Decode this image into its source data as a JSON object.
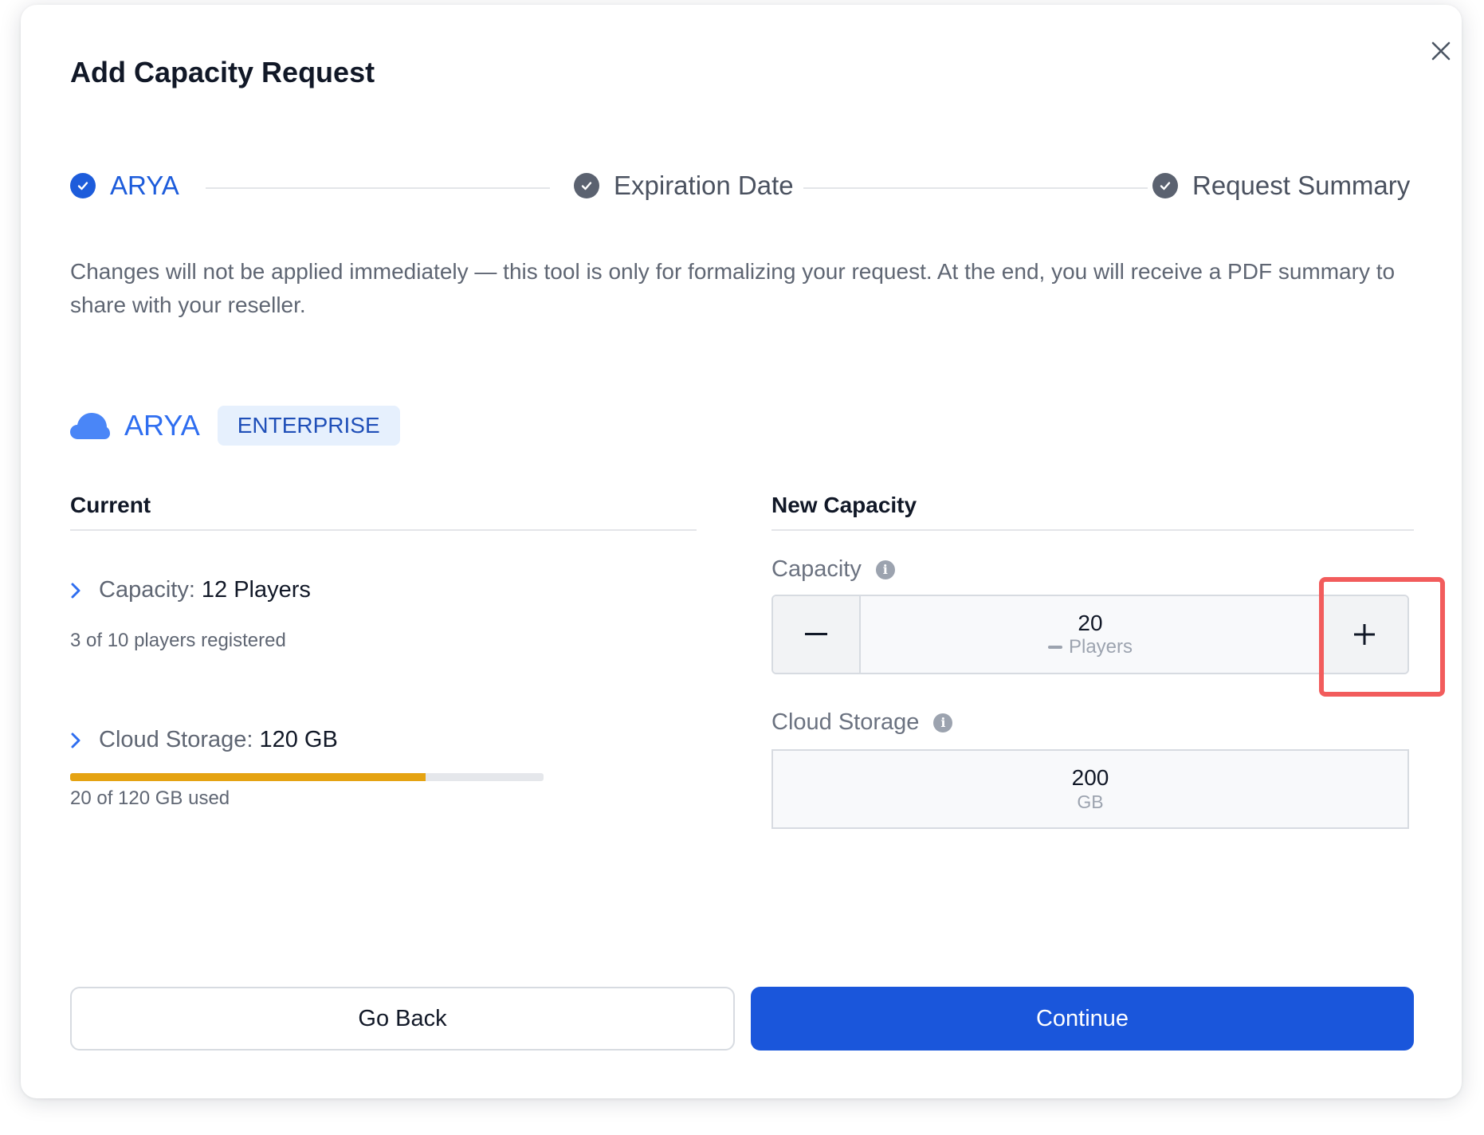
{
  "modal": {
    "title": "Add Capacity Request",
    "close_icon": "close-icon"
  },
  "stepper": {
    "steps": [
      {
        "label": "ARYA",
        "state": "active"
      },
      {
        "label": "Expiration Date",
        "state": "done"
      },
      {
        "label": "Request Summary",
        "state": "done"
      }
    ]
  },
  "description": "Changes will not be applied immediately — this tool is only for formalizing your request. At the end, you will receive a PDF summary to share with your reseller.",
  "product": {
    "name": "ARYA",
    "plan": "ENTERPRISE",
    "icon": "cloud-icon"
  },
  "current": {
    "heading": "Current",
    "capacity": {
      "label": "Capacity:",
      "value": "12 Players",
      "sub": "3 of 10 players registered"
    },
    "storage": {
      "label": "Cloud Storage:",
      "value": "120 GB",
      "sub": "20 of 120 GB used",
      "used_fraction": 0.75
    }
  },
  "new_capacity": {
    "heading": "New Capacity",
    "capacity": {
      "label": "Capacity",
      "value": "20",
      "unit": "Players"
    },
    "storage": {
      "label": "Cloud Storage",
      "value": "200",
      "unit": "GB"
    }
  },
  "actions": {
    "back": "Go Back",
    "continue": "Continue"
  },
  "colors": {
    "primary": "#1a56db",
    "accent_text": "#2f6ef0",
    "progress_fill": "#e5a312",
    "highlight": "#f25c5c"
  }
}
